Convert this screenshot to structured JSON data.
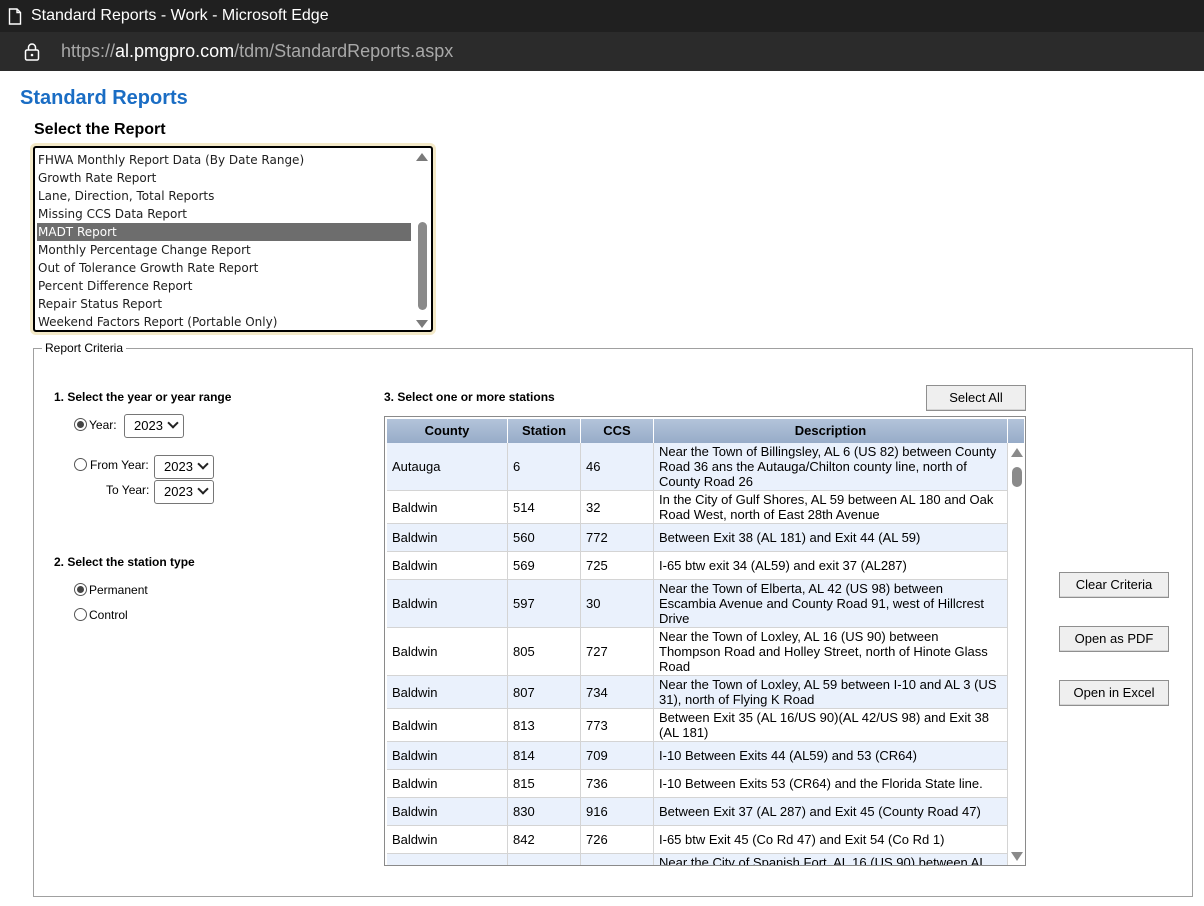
{
  "browser": {
    "window_title": "Standard Reports - Work - Microsoft Edge",
    "url_prefix": "https://",
    "url_host": "al.pmgpro.com",
    "url_path": "/tdm/StandardReports.aspx"
  },
  "page": {
    "title": "Standard Reports",
    "select_heading": "Select the Report"
  },
  "report_list": {
    "items": [
      "FHWA Monthly Report Data (By Date Range)",
      "Growth Rate Report",
      "Lane, Direction, Total Reports",
      "Missing CCS Data Report",
      "MADT Report",
      "Monthly Percentage Change Report",
      "Out of Tolerance Growth Rate Report",
      "Percent Difference Report",
      "Repair Status Report",
      "Weekend Factors Report (Portable Only)"
    ],
    "selected": "MADT Report"
  },
  "criteria": {
    "legend": "Report Criteria",
    "year_section": {
      "heading": "1. Select the year or year range",
      "year_label": "Year:",
      "year_value": "2023",
      "from_label": "From Year:",
      "from_value": "2023",
      "to_label": "To Year:",
      "to_value": "2023"
    },
    "station_type": {
      "heading": "2. Select the station type",
      "permanent": "Permanent",
      "control": "Control"
    },
    "stations": {
      "heading": "3. Select one or more stations",
      "select_all": "Select All",
      "columns": [
        "County",
        "Station",
        "CCS",
        "Description"
      ],
      "rows": [
        {
          "county": "Autauga",
          "station": "6",
          "ccs": "46",
          "desc": "Near the Town of Billingsley, AL 6 (US 82) between County Road 36 ans the Autauga/Chilton county line, north of County Road 26"
        },
        {
          "county": "Baldwin",
          "station": "514",
          "ccs": "32",
          "desc": "In the City of Gulf Shores, AL 59 between AL 180 and Oak Road West, north of East 28th Avenue"
        },
        {
          "county": "Baldwin",
          "station": "560",
          "ccs": "772",
          "desc": "Between Exit 38 (AL 181) and Exit 44 (AL 59)"
        },
        {
          "county": "Baldwin",
          "station": "569",
          "ccs": "725",
          "desc": "I-65 btw exit 34 (AL59) and exit 37 (AL287)"
        },
        {
          "county": "Baldwin",
          "station": "597",
          "ccs": "30",
          "desc": "Near the Town of Elberta, AL 42 (US 98) between Escambia Avenue and County Road 91, west of Hillcrest Drive"
        },
        {
          "county": "Baldwin",
          "station": "805",
          "ccs": "727",
          "desc": "Near the Town of Loxley, AL 16 (US 90) between Thompson Road and Holley Street, north of Hinote Glass Road"
        },
        {
          "county": "Baldwin",
          "station": "807",
          "ccs": "734",
          "desc": "Near the Town of Loxley, AL 59 between I-10 and AL 3 (US 31), north of Flying K Road"
        },
        {
          "county": "Baldwin",
          "station": "813",
          "ccs": "773",
          "desc": "Between Exit 35 (AL 16/US 90)(AL 42/US 98) and Exit 38 (AL 181)"
        },
        {
          "county": "Baldwin",
          "station": "814",
          "ccs": "709",
          "desc": "I-10 Between Exits 44 (AL59) and 53 (CR64)"
        },
        {
          "county": "Baldwin",
          "station": "815",
          "ccs": "736",
          "desc": "I-10 Between Exits 53 (CR64) and the Florida State line."
        },
        {
          "county": "Baldwin",
          "station": "830",
          "ccs": "916",
          "desc": "Between Exit 37 (AL 287) and Exit 45 (County Road 47)"
        },
        {
          "county": "Baldwin",
          "station": "842",
          "ccs": "726",
          "desc": "I-65 btw Exit 45 (Co Rd 47) and Exit 54 (Co Rd 1)"
        },
        {
          "county": "",
          "station": "",
          "ccs": "",
          "desc": "Near the City of Spanish Fort, AL 16 (US 90) between AL"
        }
      ]
    },
    "actions": {
      "clear": "Clear Criteria",
      "pdf": "Open as PDF",
      "excel": "Open in Excel"
    }
  }
}
